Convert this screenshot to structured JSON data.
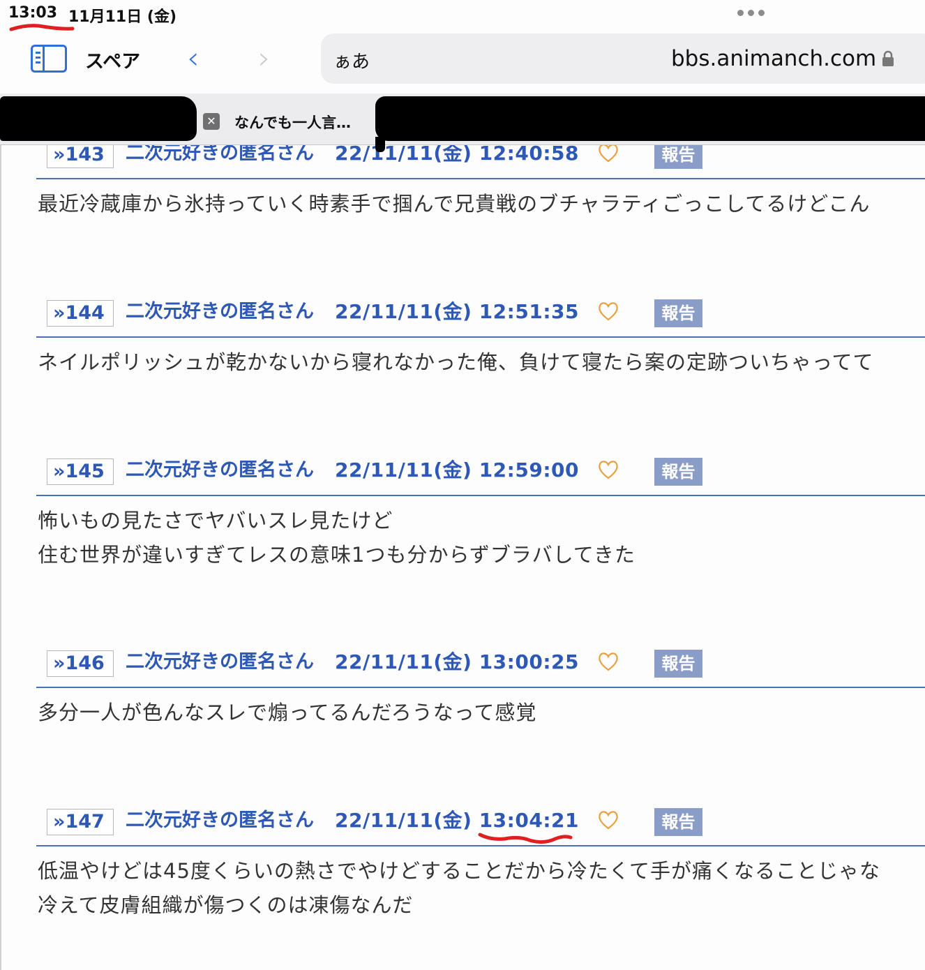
{
  "status_bar": {
    "time": "13:03",
    "date": "11月11日 (金)"
  },
  "toolbar": {
    "space_label": "スペア",
    "aa_label": "ぁあ",
    "url": "bbs.animanch.com"
  },
  "tab": {
    "close_label": "✕",
    "title": "なんでも一人言…"
  },
  "posts": [
    {
      "num": "»143",
      "name": "二次元好きの匿名さん",
      "date": "22/11/11(金) 12:40:58",
      "report": "報告",
      "lines": [
        "最近冷蔵庫から氷持っていく時素手で掴んで兄貴戦のブチャラティごっこしてるけどこん"
      ]
    },
    {
      "num": "»144",
      "name": "二次元好きの匿名さん",
      "date": "22/11/11(金) 12:51:35",
      "report": "報告",
      "lines": [
        "ネイルポリッシュが乾かないから寝れなかった俺、負けて寝たら案の定跡ついちゃってて"
      ]
    },
    {
      "num": "»145",
      "name": "二次元好きの匿名さん",
      "date": "22/11/11(金) 12:59:00",
      "report": "報告",
      "lines": [
        "怖いもの見たさでヤバいスレ見たけど",
        "住む世界が違いすぎてレスの意味1つも分からずブラバしてきた"
      ]
    },
    {
      "num": "»146",
      "name": "二次元好きの匿名さん",
      "date": "22/11/11(金) 13:00:25",
      "report": "報告",
      "lines": [
        "多分一人が色んなスレで煽ってるんだろうなって感覚"
      ]
    },
    {
      "num": "»147",
      "name": "二次元好きの匿名さん",
      "date": "22/11/11(金) 13:04:21",
      "report": "報告",
      "lines": [
        "低温やけどは45度くらいの熱さでやけどすることだから冷たくて手が痛くなることじゃな",
        "冷えて皮膚組織が傷つくのは凍傷なんだ"
      ]
    }
  ]
}
